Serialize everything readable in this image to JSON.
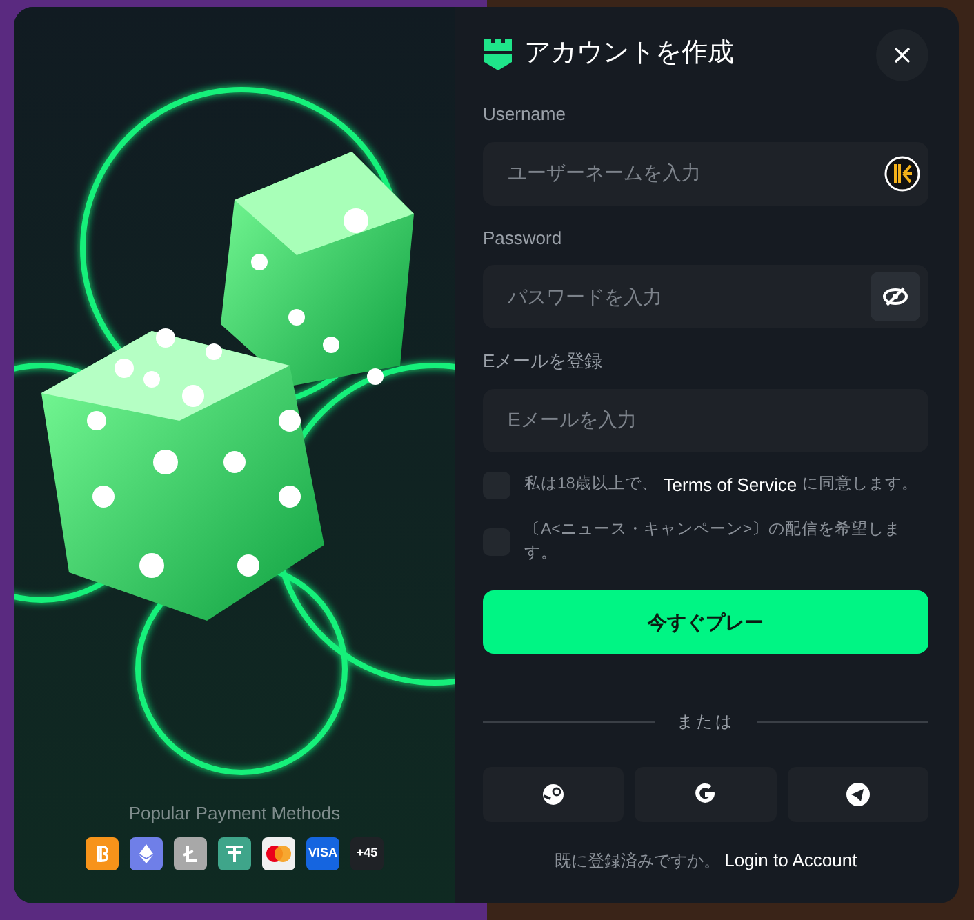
{
  "dialog": {
    "title": "アカウントを作成"
  },
  "fields": [
    {
      "kind": "username",
      "label": "Username",
      "placeholder": "ユーザーネームを入力"
    },
    {
      "kind": "password",
      "label": "Password",
      "placeholder": "パスワードを入力"
    },
    {
      "kind": "email",
      "label": "Eメールを登録",
      "placeholder": "Eメールを入力"
    }
  ],
  "checkboxes": [
    {
      "kind": "terms",
      "before": "私は18歳以上で、",
      "link": "Terms of Service",
      "after": "に同意します。",
      "checked": false
    },
    {
      "kind": "plain",
      "text": "〔A<ニュース・キャンペーン>〕の配信を希望します。",
      "checked": false
    }
  ],
  "play_button": "今すぐプレー",
  "divider": "または",
  "social_buttons": [
    {
      "kind": "steam"
    },
    {
      "kind": "google"
    },
    {
      "kind": "telegram"
    }
  ],
  "footer": {
    "text": "既に登録済みですか。",
    "link": "Login to Account"
  },
  "payments": {
    "title": "Popular Payment Methods",
    "methods": [
      {
        "kind": "bitcoin",
        "color": "#f7931a"
      },
      {
        "kind": "ethereum",
        "color": "#6f7fe8"
      },
      {
        "kind": "litecoin",
        "color": "#a8a8a8"
      },
      {
        "kind": "tether",
        "color": "#3fa58a"
      },
      {
        "kind": "mastercard",
        "color": "#f0f0f0"
      },
      {
        "kind": "visa",
        "color": "#1565e0",
        "label": "VISA"
      },
      {
        "kind": "more",
        "color": "#1f2226",
        "label": "+45"
      }
    ]
  }
}
